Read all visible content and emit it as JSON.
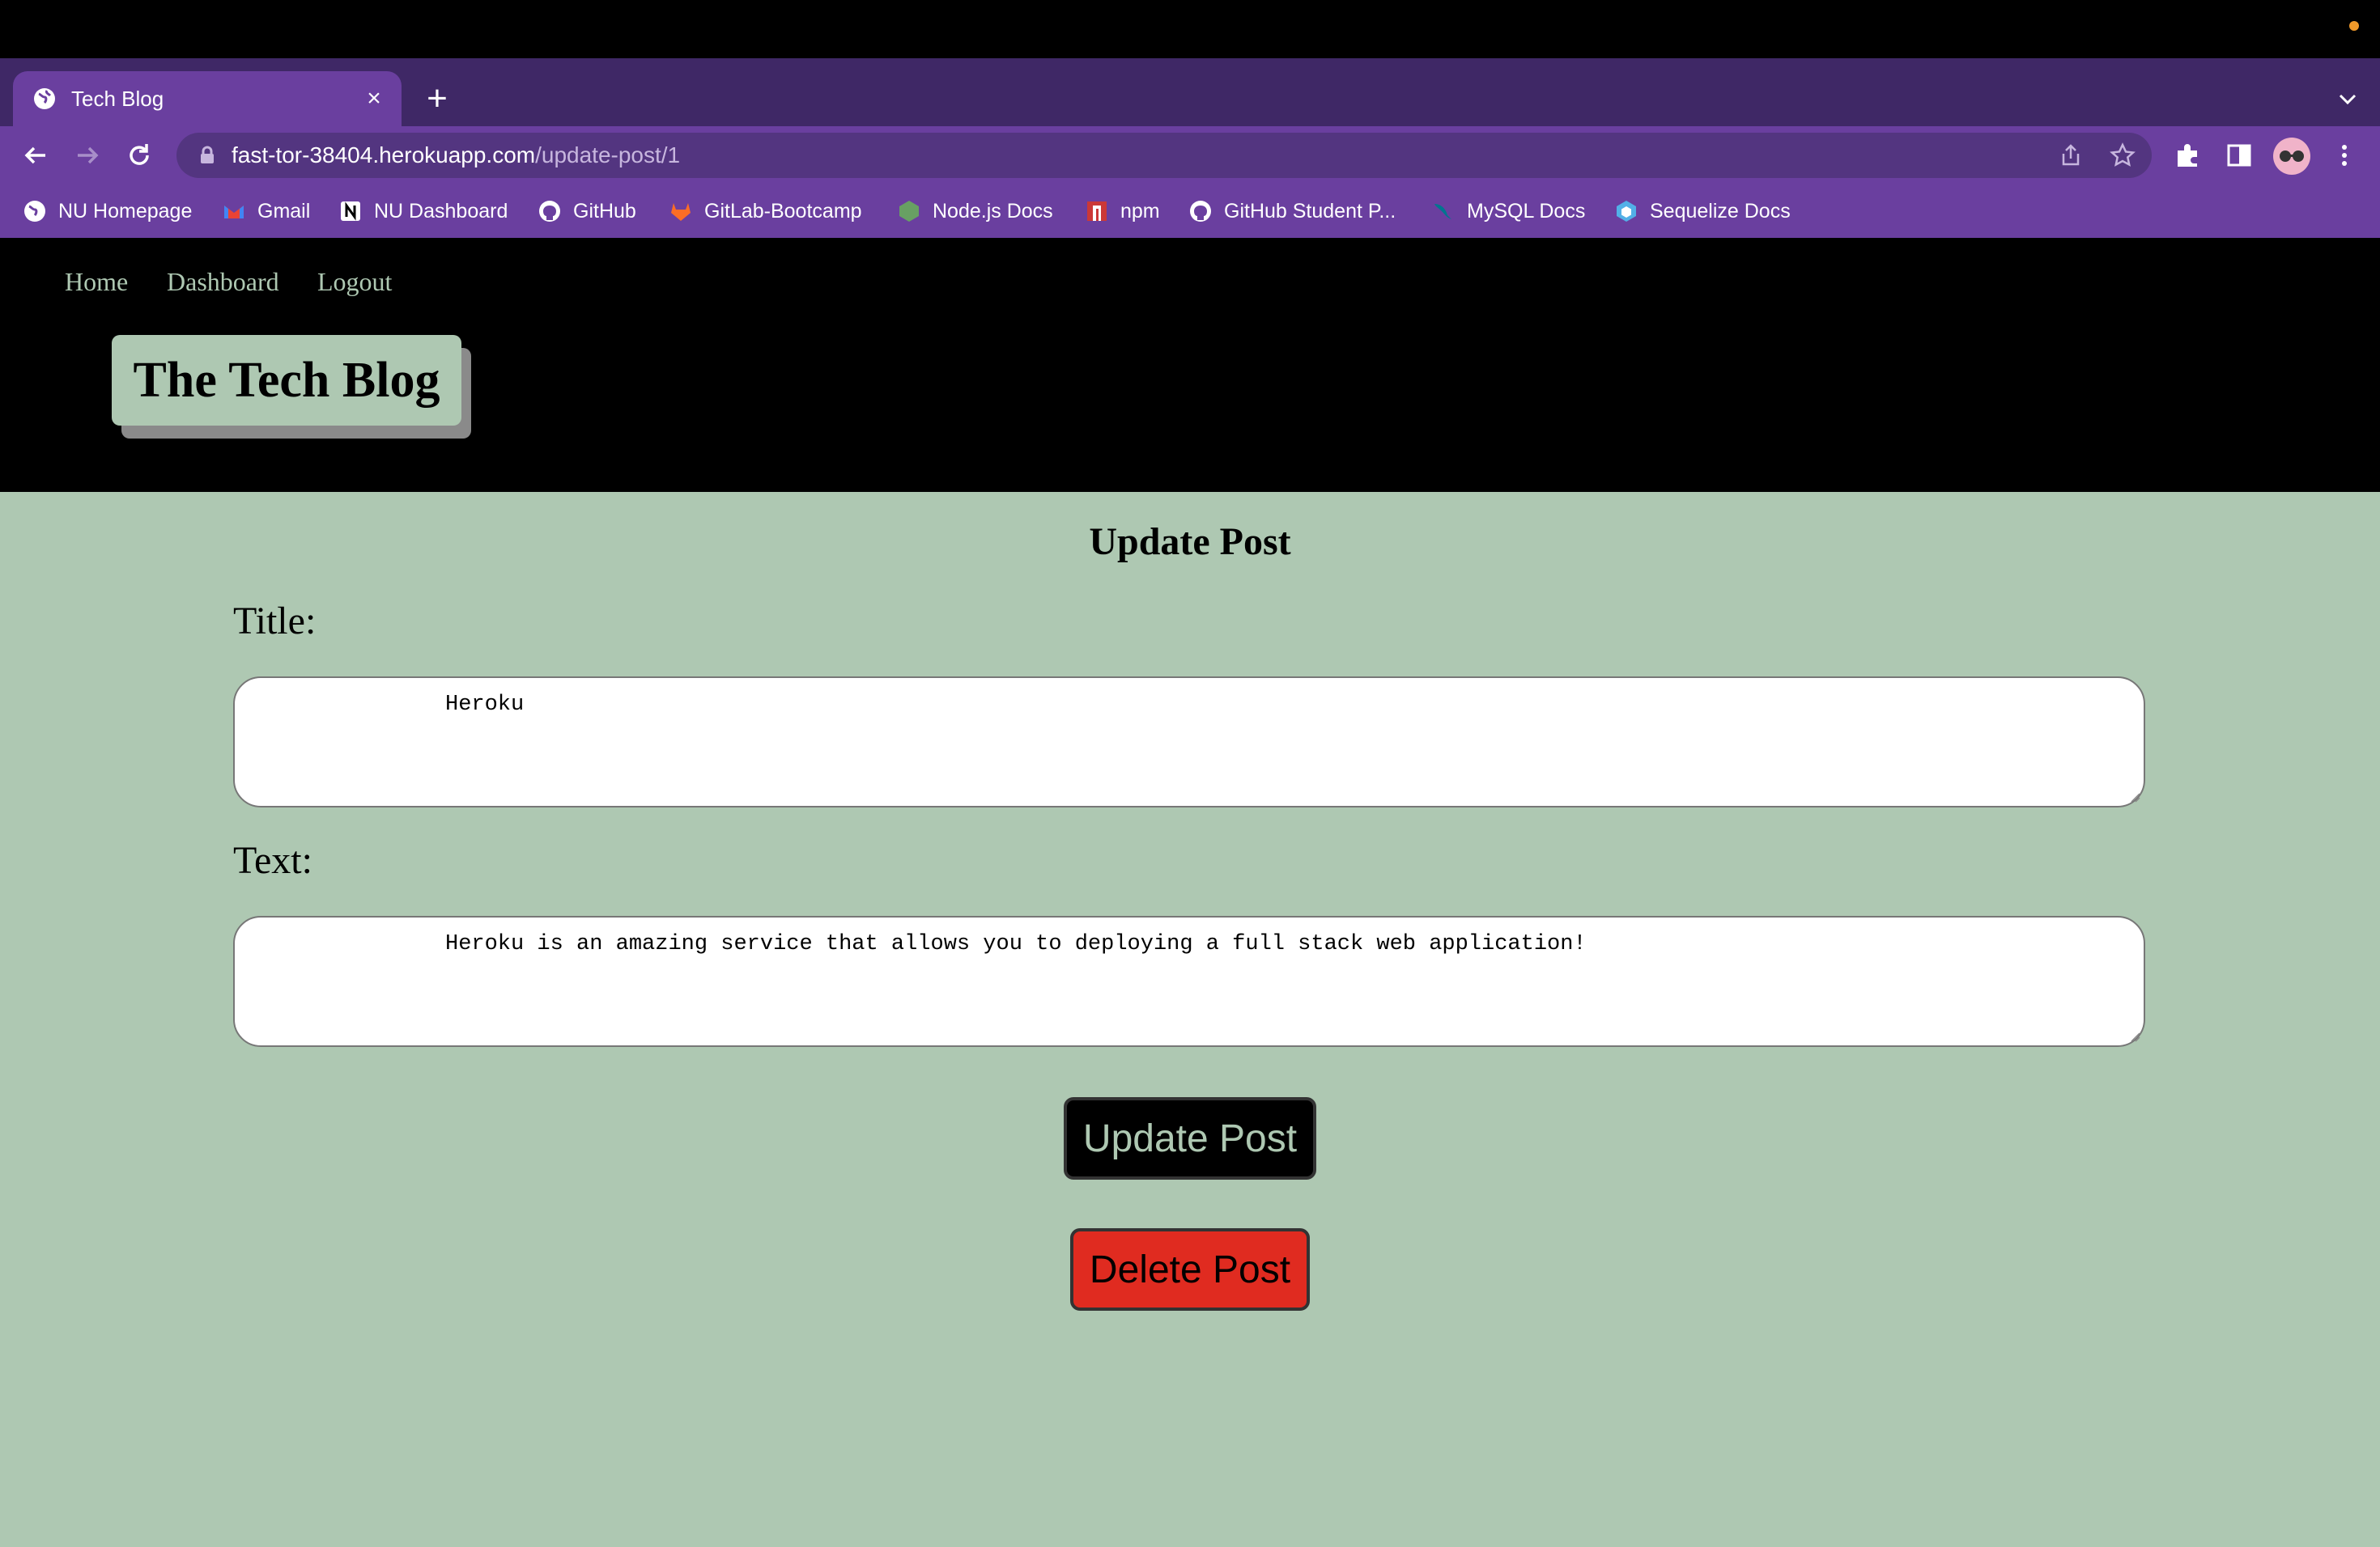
{
  "browser": {
    "tab": {
      "title": "Tech Blog",
      "close": "×"
    },
    "new_tab": "+",
    "address": {
      "host": "fast-tor-38404.herokuapp.com",
      "path": "/update-post/1"
    },
    "bookmarks": [
      {
        "label": "NU Homepage",
        "icon": "globe-icon"
      },
      {
        "label": "Gmail",
        "icon": "gmail-icon"
      },
      {
        "label": "NU Dashboard",
        "icon": "notion-icon"
      },
      {
        "label": "GitHub",
        "icon": "github-icon"
      },
      {
        "label": "GitLab-Bootcamp",
        "icon": "gitlab-icon"
      },
      {
        "label": "Node.js Docs",
        "icon": "nodejs-icon"
      },
      {
        "label": "npm",
        "icon": "npm-icon"
      },
      {
        "label": "GitHub Student P...",
        "icon": "github-icon"
      },
      {
        "label": "MySQL Docs",
        "icon": "mysql-icon"
      },
      {
        "label": "Sequelize Docs",
        "icon": "sequelize-icon"
      }
    ],
    "colors": {
      "chrome": "#6a3f9f",
      "tabstrip": "#3f2866"
    }
  },
  "site": {
    "nav": {
      "home": "Home",
      "dashboard": "Dashboard",
      "logout": "Logout"
    },
    "logo": "The Tech Blog"
  },
  "form": {
    "heading": "Update Post",
    "title_label": "Title:",
    "title_value": "Heroku",
    "text_label": "Text:",
    "text_value": "Heroku is an amazing service that allows you to deploying a full stack web application!",
    "update_button": "Update Post",
    "delete_button": "Delete Post"
  },
  "colors": {
    "page_bg": "#aec8b2",
    "header_bg": "#000000",
    "delete": "#e02b20"
  }
}
